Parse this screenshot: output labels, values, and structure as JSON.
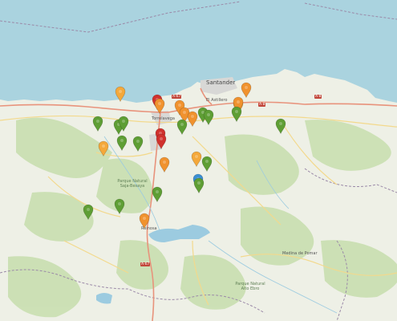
{
  "map": {
    "colors": {
      "sea": "#aad3df",
      "land": "#eef0e6",
      "forest": "#c9dfb0",
      "water": "#9ccbe0",
      "urban": "#d8d8d6",
      "motorway": "#e8937c",
      "road": "#f3d98c",
      "boundary": "#9b8aa8"
    },
    "places": {
      "santander": "Santander",
      "torrelavega": "Torrelavega",
      "el_astillero": "El Astillero",
      "parque_saja": "Parque Natural Saja-Besaya",
      "medina_pomar": "Medina de Pomar",
      "parque_sur": "Parque Natural Alto Ebro",
      "reinosa": "Reinosa"
    },
    "roads": {
      "a67_north": "A-67",
      "a8_east": "A-8",
      "a67_south": "A-67",
      "a8_west": "A-8"
    },
    "marker_colors": {
      "green": "#5e9e34",
      "orange": "#f0922e",
      "light_orange": "#f4a83a",
      "red": "#d0312d",
      "blue": "#3a8fd3"
    },
    "markers": [
      {
        "status": "light_orange"
      },
      {
        "status": "red"
      },
      {
        "status": "orange"
      },
      {
        "status": "orange"
      },
      {
        "status": "orange"
      },
      {
        "status": "orange"
      },
      {
        "status": "orange"
      },
      {
        "status": "green"
      },
      {
        "status": "green"
      },
      {
        "status": "light_orange"
      },
      {
        "status": "orange"
      },
      {
        "status": "green"
      },
      {
        "status": "green"
      },
      {
        "status": "green"
      },
      {
        "status": "green"
      },
      {
        "status": "green"
      },
      {
        "status": "green"
      },
      {
        "status": "red"
      },
      {
        "status": "red"
      },
      {
        "status": "light_orange"
      },
      {
        "status": "orange"
      },
      {
        "status": "light_orange"
      },
      {
        "status": "green"
      },
      {
        "status": "blue"
      },
      {
        "status": "green"
      },
      {
        "status": "green"
      },
      {
        "status": "green"
      },
      {
        "status": "green"
      },
      {
        "status": "orange"
      }
    ]
  }
}
